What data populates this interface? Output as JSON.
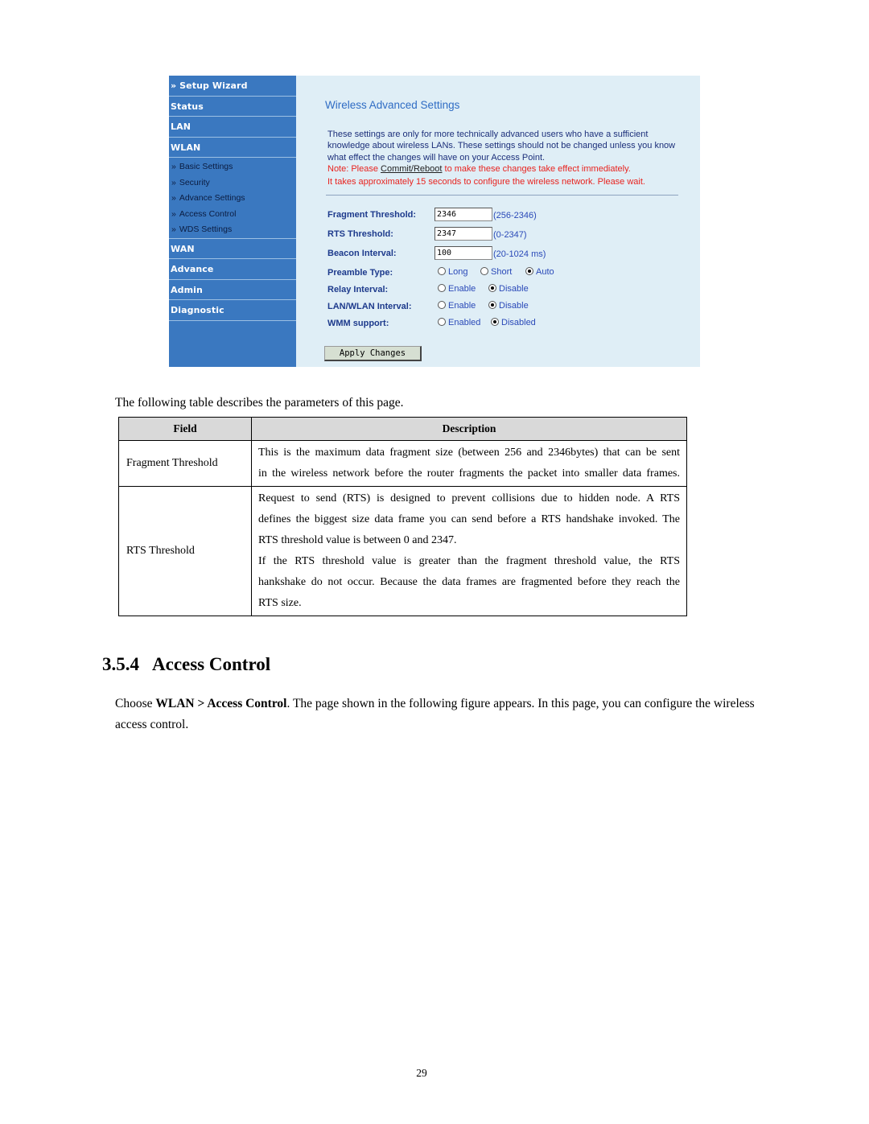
{
  "screenshot": {
    "colors": {
      "sidebar_bg": "#3a78c0",
      "content_bg": "#dfeef6",
      "title": "#2f6cc4",
      "note": "#e8231f"
    },
    "sidebar": {
      "setup_wizard": "Setup Wizard",
      "chevron_glyph": "»",
      "main_items": [
        "Status",
        "LAN",
        "WLAN"
      ],
      "wlan_sub_items": [
        "Basic Settings",
        "Security",
        "Advance Settings",
        "Access Control",
        "WDS Settings"
      ],
      "bottom_items": [
        "WAN",
        "Advance",
        "Admin",
        "Diagnostic"
      ]
    },
    "content": {
      "title": "Wireless Advanced Settings",
      "description": "These settings are only for more technically advanced users who have a sufficient knowledge about wireless LANs. These settings should not be changed unless you know what effect the changes will have on your Access Point.",
      "note_prefix": "Note: Please ",
      "note_link": "Commit/Reboot",
      "note_suffix": " to make these changes take effect immediately.",
      "wait_note": "It takes approximately 15 seconds to configure the wireless network. Please wait.",
      "fields": {
        "fragment": {
          "label": "Fragment Threshold:",
          "value": "2346",
          "range": "(256-2346)"
        },
        "rts": {
          "label": "RTS Threshold:",
          "value": "2347",
          "range": "(0-2347)"
        },
        "beacon": {
          "label": "Beacon Interval:",
          "value": "100",
          "range": "(20-1024 ms)"
        }
      },
      "radios": {
        "preamble": {
          "label": "Preamble Type:",
          "options": [
            "Long",
            "Short",
            "Auto"
          ],
          "selected": "Auto"
        },
        "relay": {
          "label": "Relay Interval:",
          "options": [
            "Enable",
            "Disable"
          ],
          "selected": "Disable"
        },
        "lanwlan": {
          "label": "LAN/WLAN Interval:",
          "options": [
            "Enable",
            "Disable"
          ],
          "selected": "Disable"
        },
        "wmm": {
          "label": "WMM support:",
          "options": [
            "Enabled",
            "Disabled"
          ],
          "selected": "Disabled"
        }
      },
      "apply_button": "Apply Changes"
    }
  },
  "document": {
    "intro": "The following table describes the parameters of this page.",
    "table": {
      "headers": [
        "Field",
        "Description"
      ],
      "rows": [
        {
          "field": "Fragment Threshold",
          "lines": [
            "This is the maximum data fragment size (between 256 and 2346bytes) that can be sent",
            "in the wireless network before the router fragments the packet into smaller data frames."
          ]
        },
        {
          "field": "RTS Threshold",
          "lines": [
            "Request to send (RTS) is designed to prevent collisions due to hidden node. A RTS",
            "defines the biggest size data frame you can send before a RTS handshake invoked. The",
            "RTS threshold value is between 0 and 2347.",
            "If the RTS threshold value is greater than the fragment threshold value, the RTS",
            "hankshake do not occur. Because the data frames are fragmented before they reach the",
            "RTS size."
          ]
        }
      ]
    },
    "section": {
      "number": "3.5.4",
      "title": "Access Control",
      "body_prefix": "Choose ",
      "body_bold": "WLAN > Access Control",
      "body_suffix": ". The page shown in the following figure appears. In this page, you can configure the wireless access control."
    },
    "page_number": "29"
  }
}
